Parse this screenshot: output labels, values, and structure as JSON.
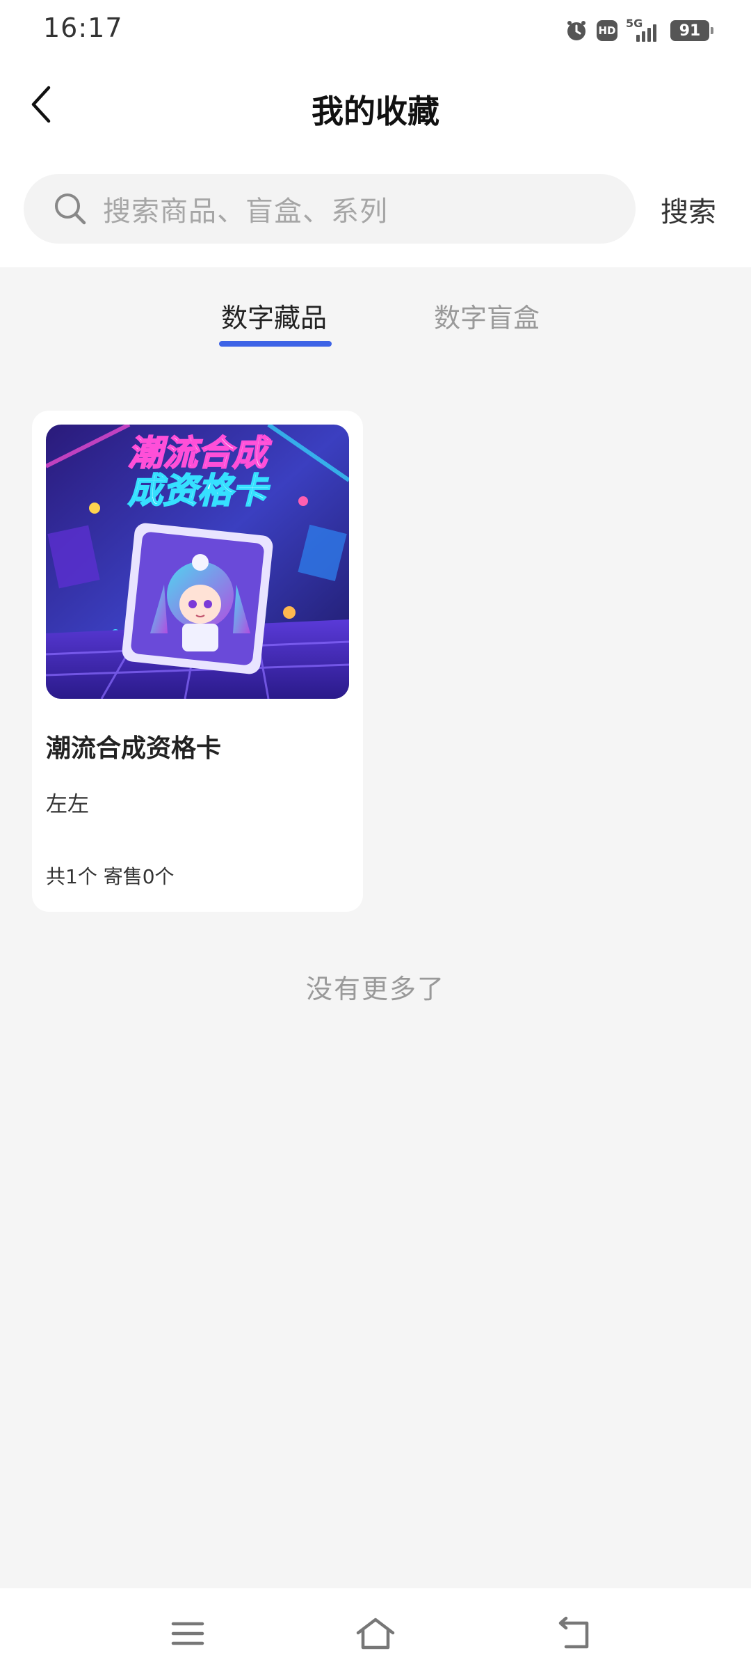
{
  "status_bar": {
    "time": "16:17",
    "network_label": "5G",
    "hd_label": "HD",
    "battery_level": "91",
    "icons": [
      "alarm-icon",
      "hd-icon",
      "signal-icon",
      "battery-icon"
    ]
  },
  "header": {
    "title": "我的收藏",
    "back_icon": "chevron-left-icon"
  },
  "search": {
    "placeholder": "搜索商品、盲盒、系列",
    "button_label": "搜索"
  },
  "tabs": [
    {
      "label": "数字藏品",
      "active": true
    },
    {
      "label": "数字盲盒",
      "active": false
    }
  ],
  "collection": [
    {
      "image_caption_line1": "潮流合成",
      "image_caption_line2": "成资格卡",
      "title": "潮流合成资格卡",
      "owner": "左左",
      "stats": "共1个 寄售0个"
    }
  ],
  "list_end_text": "没有更多了",
  "nav_bar": {
    "icons": [
      "menu-icon",
      "home-icon",
      "back-icon"
    ]
  },
  "colors": {
    "accent": "#3d63e6",
    "background": "#f5f5f5",
    "card": "#ffffff",
    "muted_text": "#999999"
  }
}
